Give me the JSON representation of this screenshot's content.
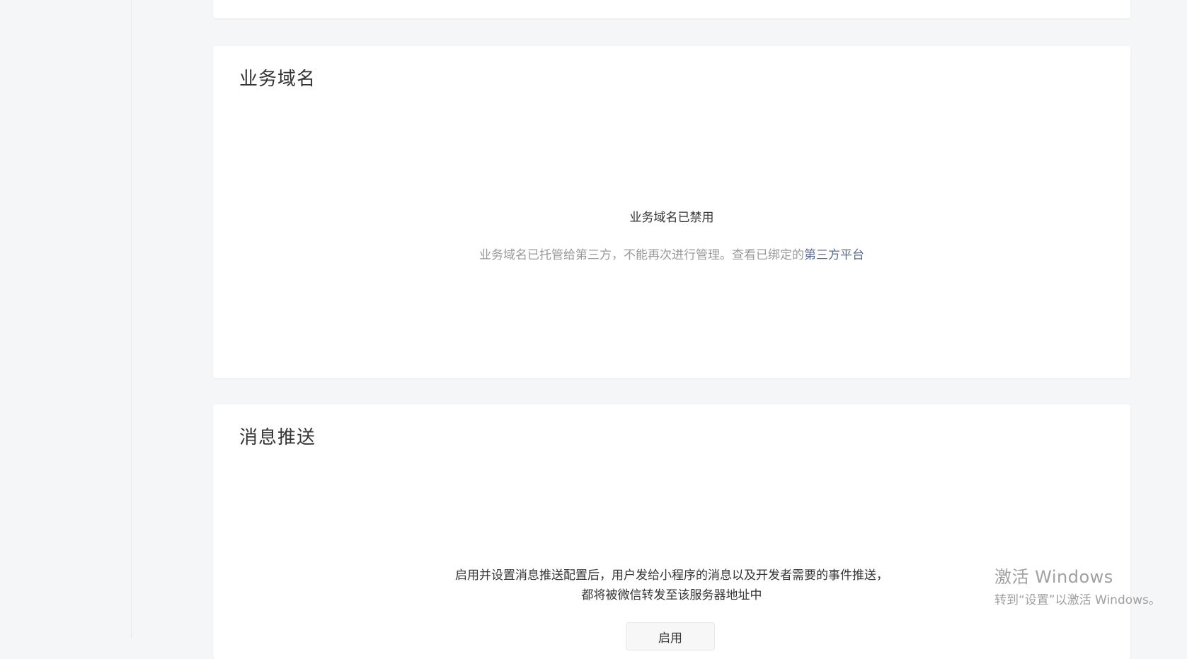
{
  "domain_section": {
    "title": "业务域名",
    "status": "业务域名已禁用",
    "description": "业务域名已托管给第三方，不能再次进行管理。查看已绑定的",
    "link_label": "第三方平台"
  },
  "push_section": {
    "title": "消息推送",
    "description": "启用并设置消息推送配置后，用户发给小程序的消息以及开发者需要的事件推送，都将被微信转发至该服务器地址中",
    "enable_label": "启用"
  },
  "watermark": {
    "title": "激活 Windows",
    "subtitle": "转到“设置”以激活 Windows。"
  },
  "colors": {
    "background": "#f5f6f7",
    "card": "#ffffff",
    "link": "#576b95",
    "muted_text": "#9a9a9a"
  }
}
